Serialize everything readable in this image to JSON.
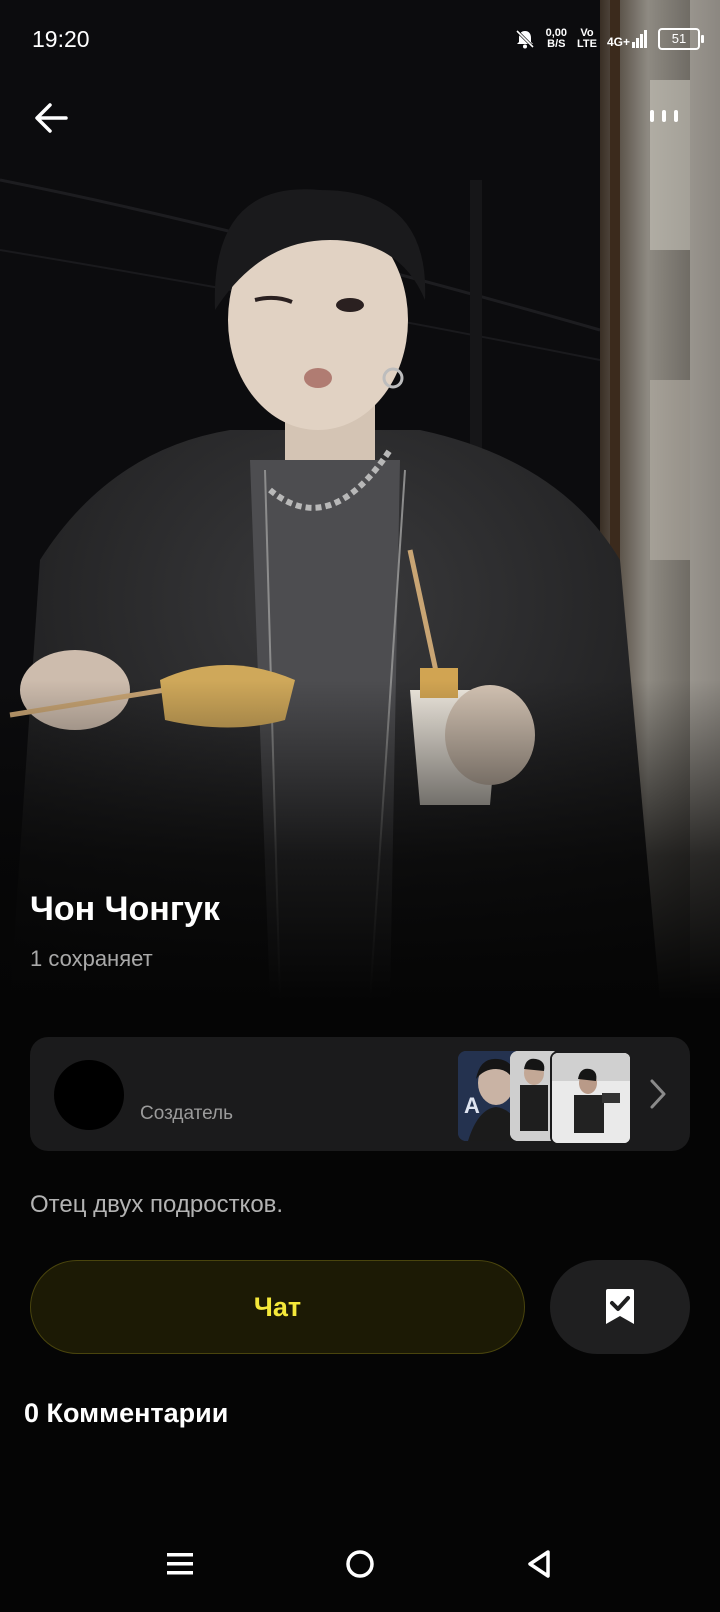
{
  "status_bar": {
    "time": "19:20",
    "net_speed_value": "0,00",
    "net_speed_unit": "B/S",
    "volte_top": "Vo",
    "volte_bottom": "LTE",
    "network": "4G+",
    "battery": "51"
  },
  "profile": {
    "name": "Чон Чонгук",
    "saves_text": "1 сохраняет",
    "creator_label": "Создатель",
    "description": "Отец двух подростков.",
    "comments_title": "0 Комментарии"
  },
  "actions": {
    "chat_label": "Чат"
  },
  "colors": {
    "background": "#050505",
    "chat_accent": "#f4e83a",
    "chat_bg": "#1c1a05",
    "card_bg": "#1b1b1c"
  },
  "icons": {
    "back": "arrow-left-icon",
    "more": "more-vertical-icon",
    "chevron": "chevron-right-icon",
    "bookmark": "bookmark-check-icon",
    "nav_menu": "menu-icon",
    "nav_home": "home-circle-icon",
    "nav_back": "triangle-back-icon"
  }
}
